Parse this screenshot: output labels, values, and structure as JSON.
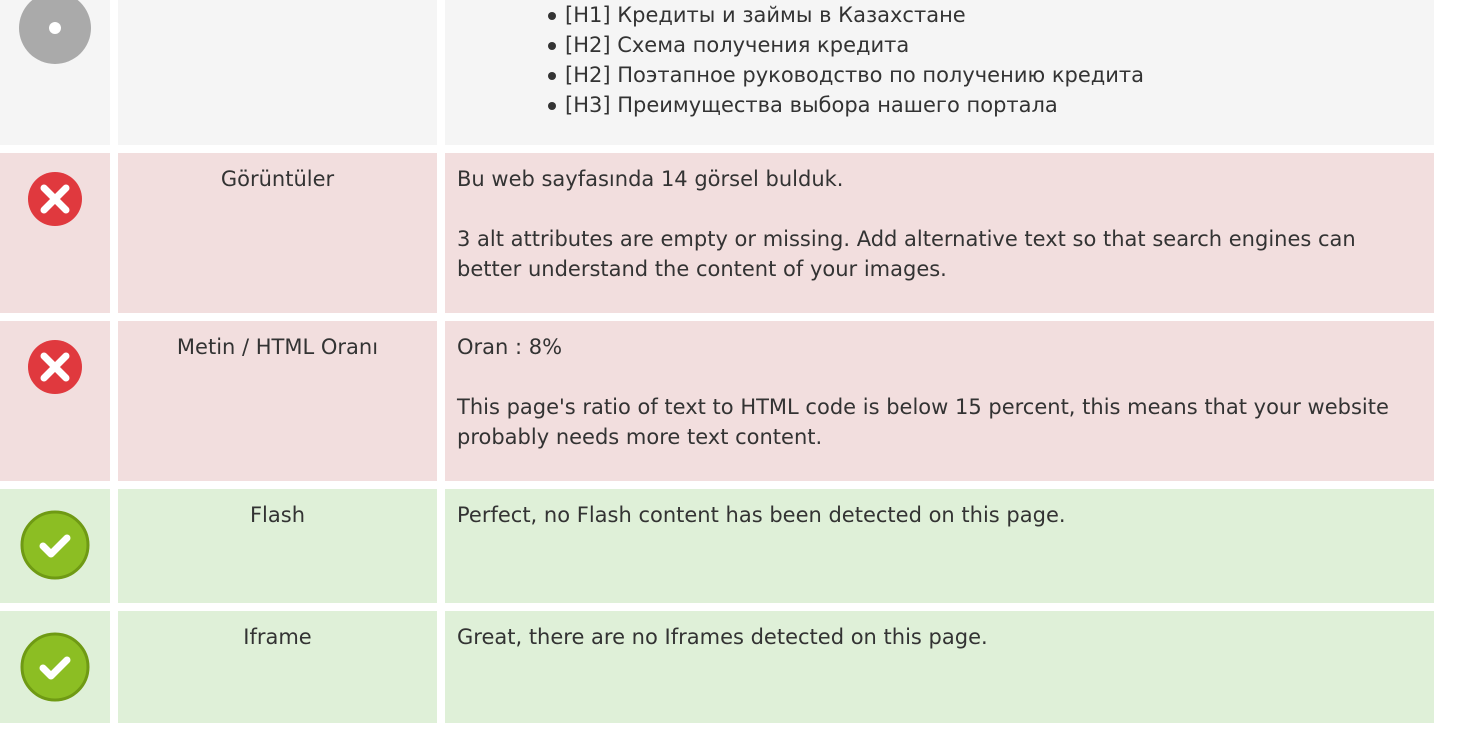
{
  "colors": {
    "neutral_bg": "#f5f5f5",
    "error_bg": "#f2dede",
    "ok_bg": "#dff0d8",
    "error_icon": "#e0393e",
    "ok_icon": "#8cbe23"
  },
  "headings_row": {
    "icon": "info-circle-icon",
    "items": [
      "[H1] Кредиты и займы в Казахстане",
      "[H2] Схема получения кредита",
      "[H2] Поэтапное руководство по получению кредита",
      "[H3] Преимущества выбора нашего портала"
    ]
  },
  "rows": [
    {
      "status": "error",
      "icon": "error-x-icon",
      "name": "Görüntüler",
      "lines": [
        "Bu web sayfasında 14 görsel bulduk.",
        "3 alt attributes are empty or missing. Add alternative text so that search engines can better understand the content of your images."
      ]
    },
    {
      "status": "error",
      "icon": "error-x-icon",
      "name": "Metin / HTML Oranı",
      "lines": [
        "Oran : 8%",
        "This page's ratio of text to HTML code is below 15 percent, this means that your website probably needs more text content."
      ]
    },
    {
      "status": "ok",
      "icon": "check-icon",
      "name": "Flash",
      "lines": [
        "Perfect, no Flash content has been detected on this page."
      ]
    },
    {
      "status": "ok",
      "icon": "check-icon",
      "name": "Iframe",
      "lines": [
        "Great, there are no Iframes detected on this page."
      ]
    }
  ]
}
